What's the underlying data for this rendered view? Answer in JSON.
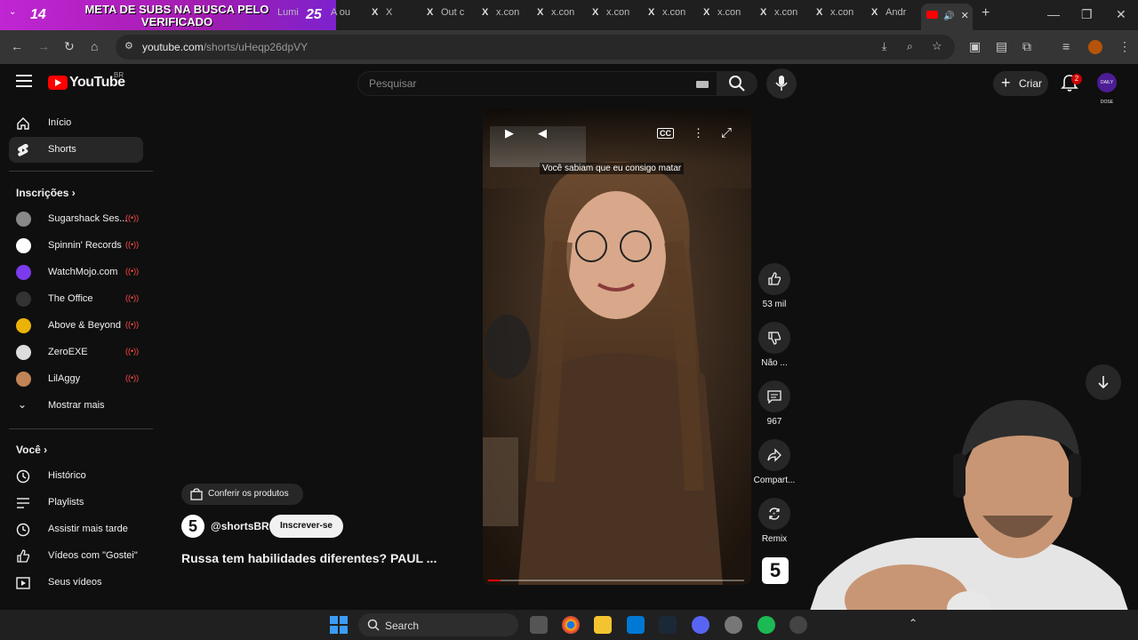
{
  "browser": {
    "sub_goal_count": "14",
    "sub_goal_text": "META DE SUBS NA BUSCA PELO VERIFICADO",
    "sub_goal_count2": "25",
    "tabs": [
      {
        "icon": "",
        "title": "Lumi"
      },
      {
        "icon": "",
        "title": "A ou"
      },
      {
        "icon": "X",
        "title": "X"
      },
      {
        "icon": "X",
        "title": "Out c"
      },
      {
        "icon": "X",
        "title": "x.con"
      },
      {
        "icon": "X",
        "title": "x.con"
      },
      {
        "icon": "X",
        "title": "x.con"
      },
      {
        "icon": "X",
        "title": "x.con"
      },
      {
        "icon": "X",
        "title": "x.con"
      },
      {
        "icon": "X",
        "title": "x.con"
      },
      {
        "icon": "X",
        "title": "x.con"
      },
      {
        "icon": "X",
        "title": "Andr"
      }
    ],
    "url_host": "youtube.com",
    "url_path": "/shorts/uHeqp26dpVY"
  },
  "youtube": {
    "wordmark": "YouTube",
    "region": "BR",
    "search_placeholder": "Pesquisar",
    "create_label": "Criar",
    "notif_count": "2",
    "avatar_text": "DAILY DOSE"
  },
  "sidebar": {
    "main": [
      {
        "label": "Início",
        "icon": "home-icon"
      },
      {
        "label": "Shorts",
        "icon": "shorts-icon"
      }
    ],
    "subs_title": "Inscrições",
    "subscriptions": [
      {
        "label": "Sugarshack Ses...",
        "color": "#888888"
      },
      {
        "label": "Spinnin' Records",
        "color": "#ffffff"
      },
      {
        "label": "WatchMojo.com",
        "color": "#7c3aed"
      },
      {
        "label": "The Office",
        "color": "#333333"
      },
      {
        "label": "Above & Beyond",
        "color": "#eab308"
      },
      {
        "label": "ZeroEXE",
        "color": "#dddddd"
      },
      {
        "label": "LilAggy",
        "color": "#c08457"
      }
    ],
    "show_more": "Mostrar mais",
    "you_title": "Você",
    "you_items": [
      {
        "label": "Histórico",
        "icon": "history-icon"
      },
      {
        "label": "Playlists",
        "icon": "playlist-icon"
      },
      {
        "label": "Assistir mais tarde",
        "icon": "clock-icon"
      },
      {
        "label": "Vídeos com \"Gostei\"",
        "icon": "thumb-up-icon"
      },
      {
        "label": "Seus vídeos",
        "icon": "video-icon"
      }
    ]
  },
  "short": {
    "caption": "Você sabiam que eu consigo matar",
    "products_label": "Conferir os produtos",
    "channel_handle": "@shortsBR",
    "channel_avatar_text": "5",
    "subscribe_label": "Inscrever-se",
    "title": "Russa tem habilidades diferentes? PAUL ...",
    "progress": 0.05,
    "actions": {
      "like": "53 mil",
      "dislike": "Não ...",
      "comments": "967",
      "share": "Compart...",
      "remix": "Remix"
    }
  },
  "taskbar": {
    "search_label": "Search"
  }
}
